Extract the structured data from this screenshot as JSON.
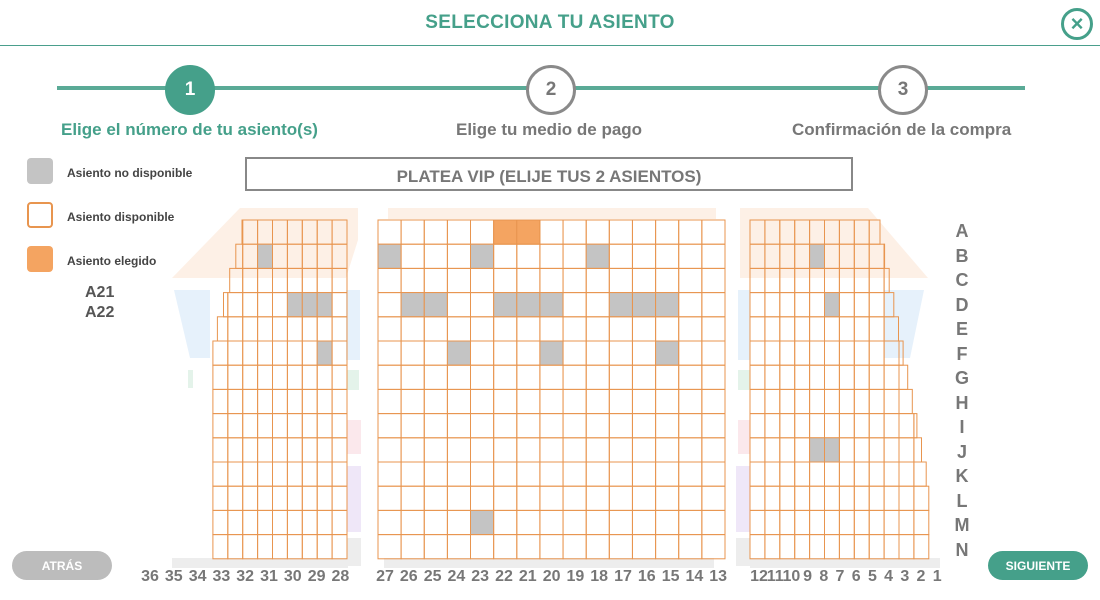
{
  "header": {
    "title": "SELECCIONA TU ASIENTO"
  },
  "steps": [
    {
      "number": "1",
      "label": "Elige el número de tu asiento(s)",
      "active": true
    },
    {
      "number": "2",
      "label": "Elige tu medio de pago",
      "active": false
    },
    {
      "number": "3",
      "label": "Confirmación de la compra",
      "active": false
    }
  ],
  "legend": {
    "unavailable": "Asiento no disponible",
    "available": "Asiento disponible",
    "chosen": "Asiento elegido"
  },
  "selected_seats": [
    "A21",
    "A22"
  ],
  "section_title": "PLATEA VIP (ELIJE TUS 2 ASIENTOS)",
  "rows": [
    "A",
    "B",
    "C",
    "D",
    "E",
    "F",
    "G",
    "H",
    "I",
    "J",
    "K",
    "L",
    "M",
    "N"
  ],
  "seat_numbers": {
    "left": [
      "36",
      "35",
      "34",
      "33",
      "32",
      "31",
      "30",
      "29",
      "28"
    ],
    "center": [
      "27",
      "26",
      "25",
      "24",
      "23",
      "22",
      "21",
      "20",
      "19",
      "18",
      "17",
      "16",
      "15",
      "14",
      "13"
    ],
    "right": [
      "12",
      "11",
      "10",
      "9",
      "8",
      "7",
      "6",
      "5",
      "4",
      "3",
      "2",
      "1"
    ]
  },
  "seat_states": {
    "chosen": [
      "A21",
      "A22"
    ],
    "unavailable": [
      "B33",
      "B27",
      "B23",
      "B18",
      "B8",
      "D31",
      "D30",
      "D29",
      "D26",
      "D25",
      "D22",
      "D21",
      "D20",
      "D17",
      "D16",
      "D15",
      "D7",
      "F29",
      "F24",
      "F20",
      "F15",
      "J8",
      "J7",
      "M23"
    ]
  },
  "colors": {
    "accent": "#45a08a",
    "seat_border": "#e8954f",
    "chosen": "#f4a461",
    "unavailable": "#c4c4c4"
  },
  "buttons": {
    "back": "ATRÁS",
    "next": "SIGUIENTE"
  }
}
